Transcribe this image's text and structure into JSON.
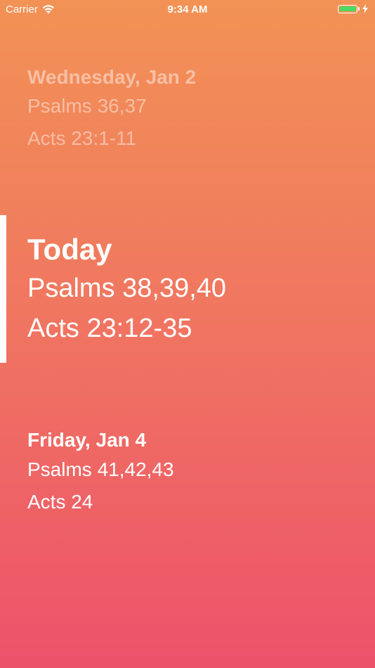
{
  "status_bar": {
    "carrier": "Carrier",
    "time": "9:34 AM",
    "battery_color": "#4cd964"
  },
  "readings": {
    "previous": {
      "heading": "Wednesday, Jan 2",
      "passages": [
        "Psalms 36,37",
        "Acts 23:1-11"
      ]
    },
    "today": {
      "heading": "Today",
      "passages": [
        "Psalms 38,39,40",
        "Acts 23:12-35"
      ]
    },
    "next": {
      "heading": "Friday, Jan 4",
      "passages": [
        "Psalms 41,42,43",
        "Acts 24"
      ]
    }
  },
  "colors": {
    "gradient_top": "#f29255",
    "gradient_bottom": "#ed526b",
    "text": "#ffffff"
  }
}
